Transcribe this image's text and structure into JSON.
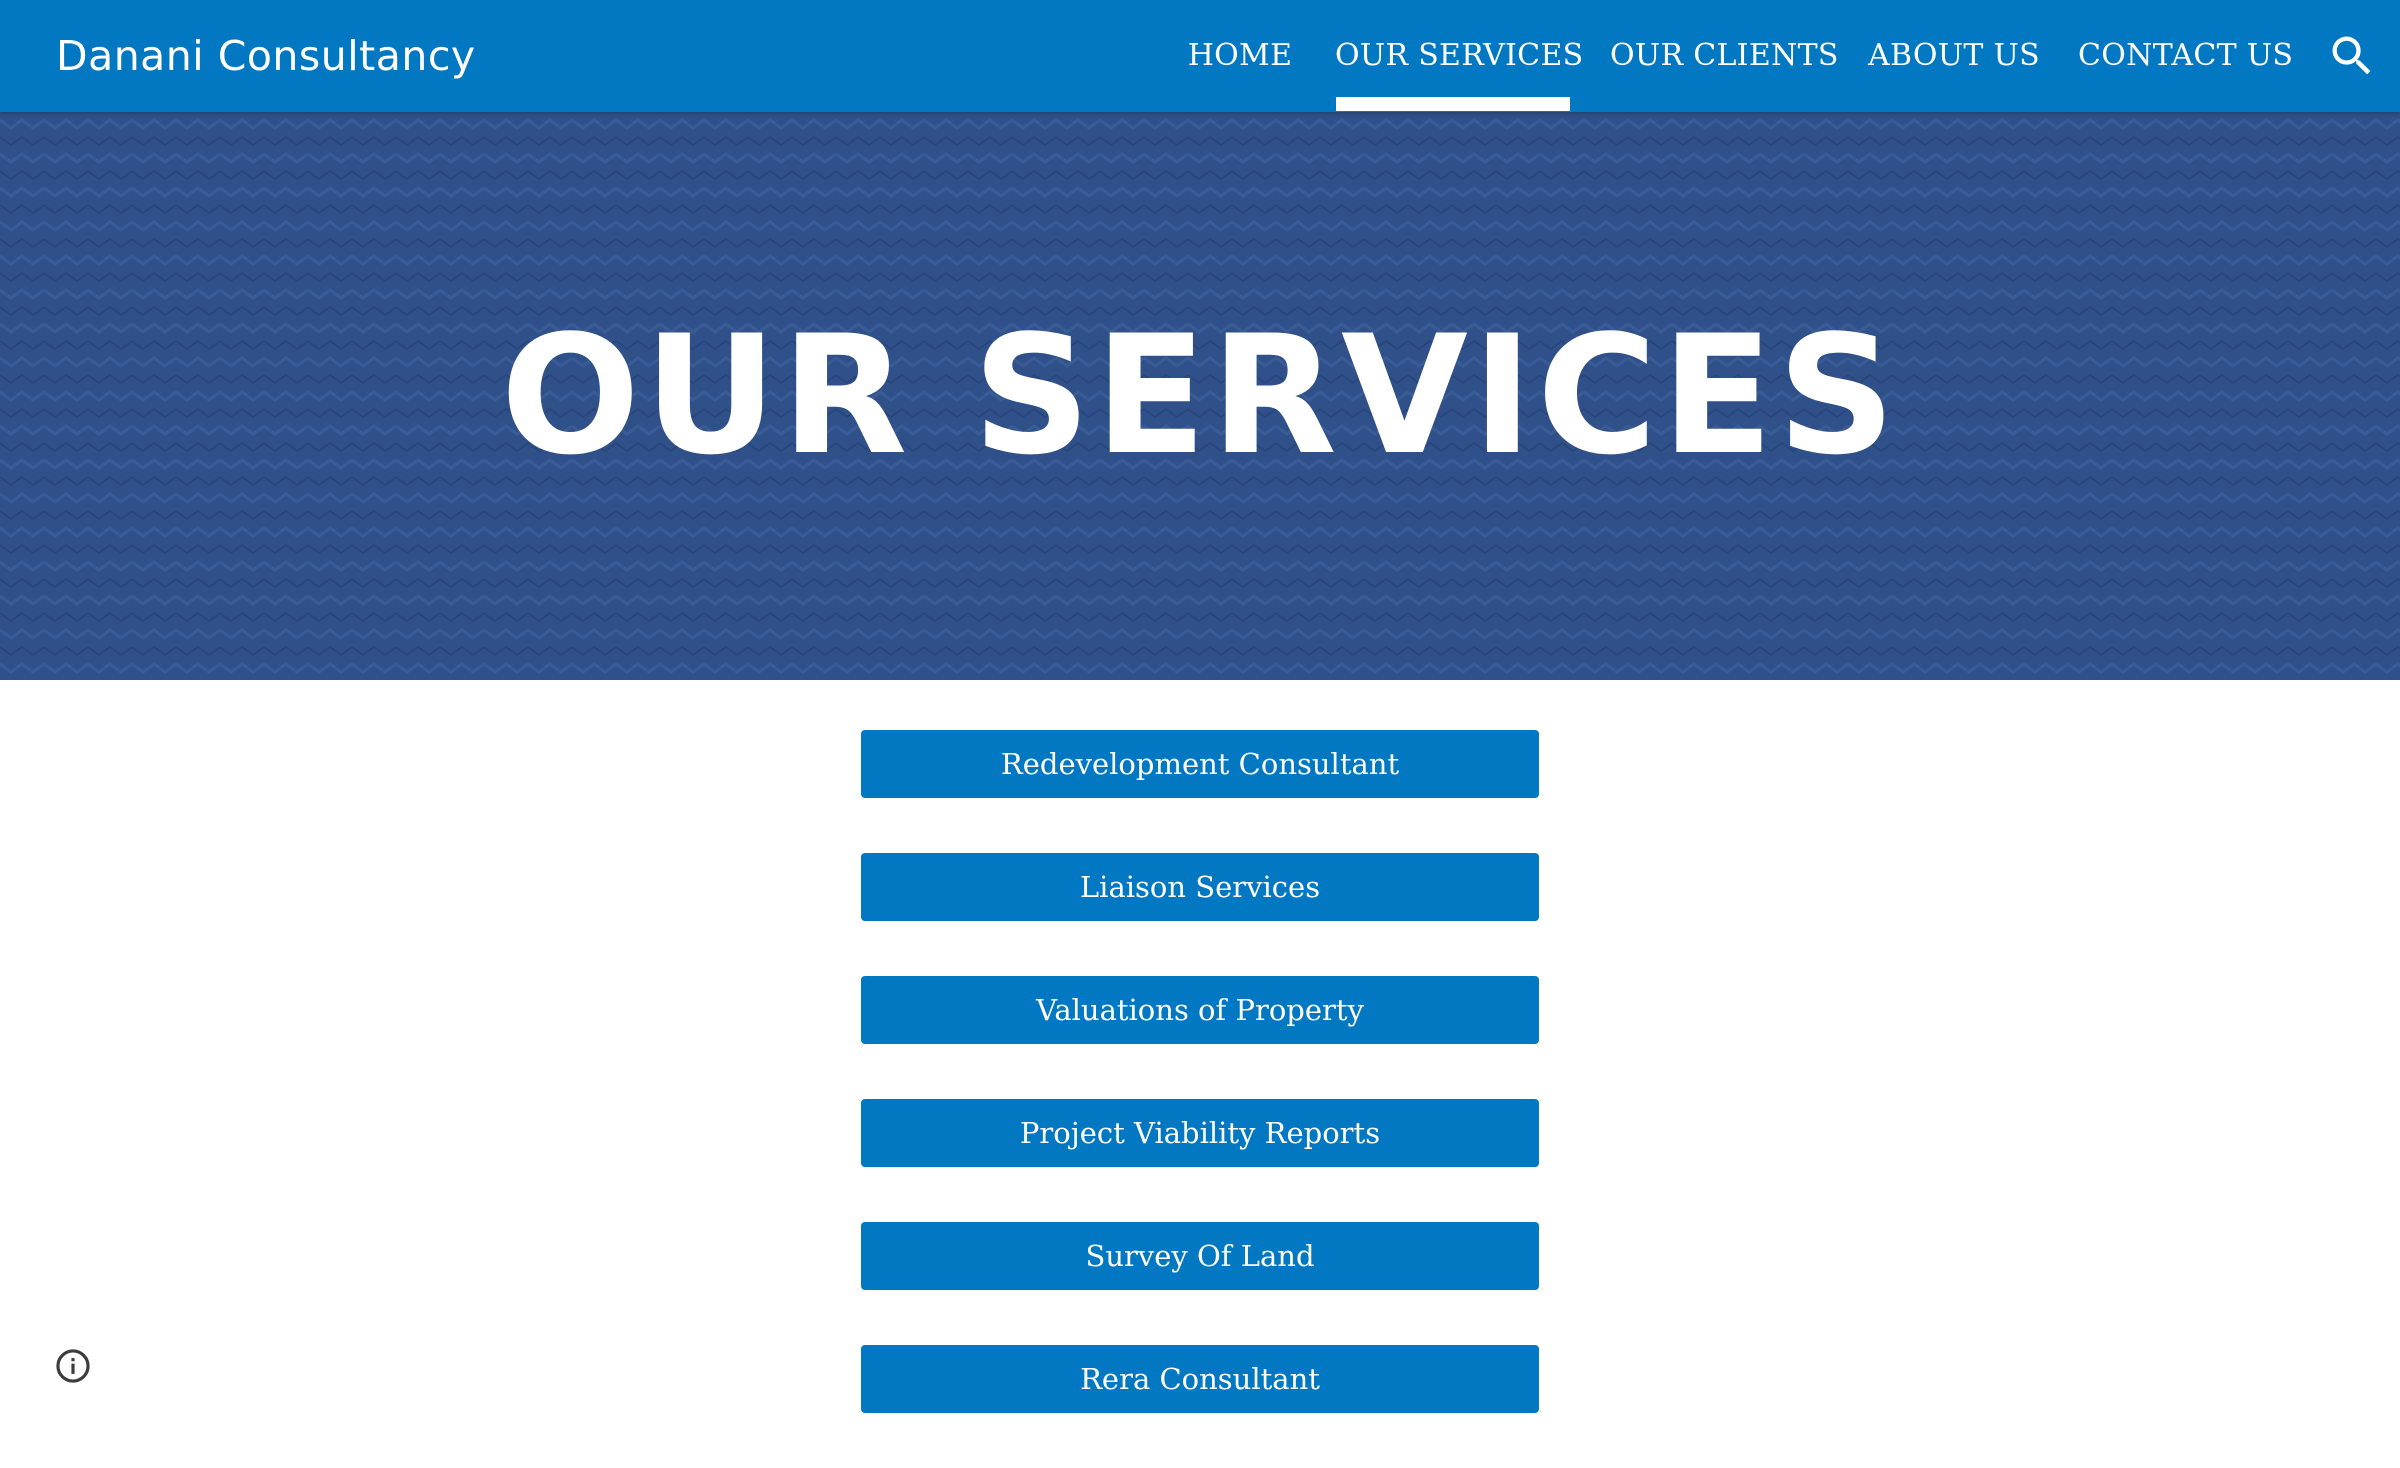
{
  "header": {
    "site_title": "Danani Consultancy",
    "background_color": "#0278c2",
    "nav": [
      {
        "label": "HOME",
        "active": false
      },
      {
        "label": "OUR SERVICES",
        "active": true
      },
      {
        "label": "OUR CLIENTS",
        "active": false
      },
      {
        "label": "ABOUT US",
        "active": false
      },
      {
        "label": "CONTACT US",
        "active": false
      }
    ],
    "search_icon": "search-icon"
  },
  "hero": {
    "title": "OUR SERVICES",
    "background_color": "#2f5089",
    "pattern": "chevron-zigzag"
  },
  "services": [
    {
      "label": "Redevelopment Consultant"
    },
    {
      "label": "Liaison Services"
    },
    {
      "label": "Valuations of Property"
    },
    {
      "label": "Project Viability Reports"
    },
    {
      "label": "Survey Of Land"
    },
    {
      "label": "Rera Consultant"
    }
  ],
  "button_color": "#0278c2",
  "footer": {
    "info_icon": "info-icon"
  }
}
